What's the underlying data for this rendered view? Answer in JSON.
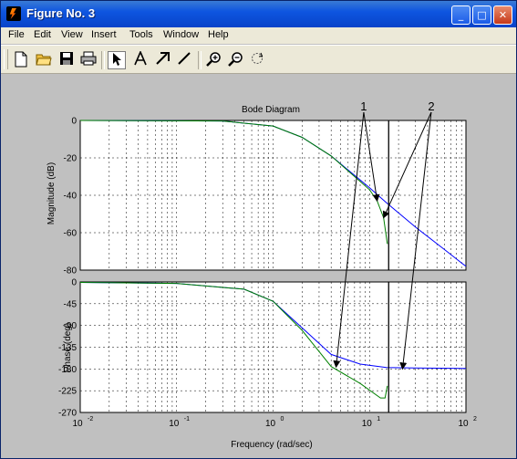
{
  "window": {
    "title": "Figure No. 3"
  },
  "titlebar_buttons": {
    "minimize": "_",
    "maximize": "□",
    "close": "✕"
  },
  "menu": [
    "File",
    "Edit",
    "View",
    "Insert",
    "Tools",
    "Window",
    "Help"
  ],
  "toolbar": [
    "new-figure-icon",
    "open-file-icon",
    "save-icon",
    "print-icon",
    "select-arrow-icon",
    "insert-text-icon",
    "insert-arrow-icon",
    "insert-line-icon",
    "zoom-in-icon",
    "zoom-out-icon",
    "rotate-3d-icon"
  ],
  "chart_data": {
    "type": "line",
    "title": "Bode Diagram",
    "xlabel": "Frequency  (rad/sec)",
    "x_ticks": [
      {
        "base": "10",
        "exp": "-2"
      },
      {
        "base": "10",
        "exp": "-1"
      },
      {
        "base": "10",
        "exp": "0"
      },
      {
        "base": "10",
        "exp": "1"
      },
      {
        "base": "10",
        "exp": "2"
      }
    ],
    "xscale": "log",
    "xlim": [
      0.01,
      100
    ],
    "grid": true,
    "magnitude": {
      "ylabel": "Magnitude (dB)",
      "ylim": [
        -80,
        0
      ],
      "yticks": [
        "0",
        "-20",
        "-40",
        "-60",
        "-80"
      ],
      "series": [
        {
          "color": "#0000ff",
          "points": [
            [
              0.01,
              0
            ],
            [
              0.3,
              -0.3
            ],
            [
              1,
              -3
            ],
            [
              2,
              -9
            ],
            [
              4,
              -19
            ],
            [
              10,
              -36
            ],
            [
              15,
              -44
            ],
            [
              30,
              -57
            ],
            [
              60,
              -69
            ],
            [
              100,
              -78
            ]
          ]
        },
        {
          "color": "#008000",
          "points": [
            [
              0.01,
              0
            ],
            [
              0.3,
              -0.3
            ],
            [
              1,
              -3
            ],
            [
              2,
              -9
            ],
            [
              4,
              -19
            ],
            [
              10,
              -37
            ],
            [
              12,
              -43
            ],
            [
              14,
              -52
            ],
            [
              15.3,
              -66
            ]
          ]
        }
      ]
    },
    "phase": {
      "ylabel": "Phase (deg)",
      "ylim": [
        -270,
        0
      ],
      "yticks": [
        "0",
        "-45",
        "-90",
        "-135",
        "-180",
        "-225",
        "-270"
      ],
      "series": [
        {
          "color": "#0000ff",
          "points": [
            [
              0.01,
              -1
            ],
            [
              0.1,
              -3
            ],
            [
              0.5,
              -15
            ],
            [
              1,
              -40
            ],
            [
              2,
              -95
            ],
            [
              4,
              -150
            ],
            [
              8,
              -170
            ],
            [
              15,
              -177
            ],
            [
              30,
              -178
            ],
            [
              100,
              -179
            ]
          ]
        },
        {
          "color": "#008000",
          "points": [
            [
              0.01,
              -1
            ],
            [
              0.1,
              -3
            ],
            [
              0.5,
              -15
            ],
            [
              1,
              -40
            ],
            [
              2,
              -100
            ],
            [
              4,
              -175
            ],
            [
              8,
              -210
            ],
            [
              13,
              -240
            ],
            [
              14.5,
              -240
            ],
            [
              15.3,
              -215
            ]
          ]
        }
      ]
    },
    "vertical_marker_x": 15.8,
    "annotations": [
      {
        "label": "1",
        "anchor": [
          0.47,
          73.5
        ],
        "targets": [
          [
            "mag",
            12,
            -43
          ],
          [
            "phase",
            4.5,
            -176
          ]
        ]
      },
      {
        "label": "2",
        "anchor": [
          0.47,
          91
        ],
        "targets": [
          [
            "mag",
            14,
            -52
          ],
          [
            "phase",
            22,
            -180
          ]
        ]
      }
    ]
  }
}
